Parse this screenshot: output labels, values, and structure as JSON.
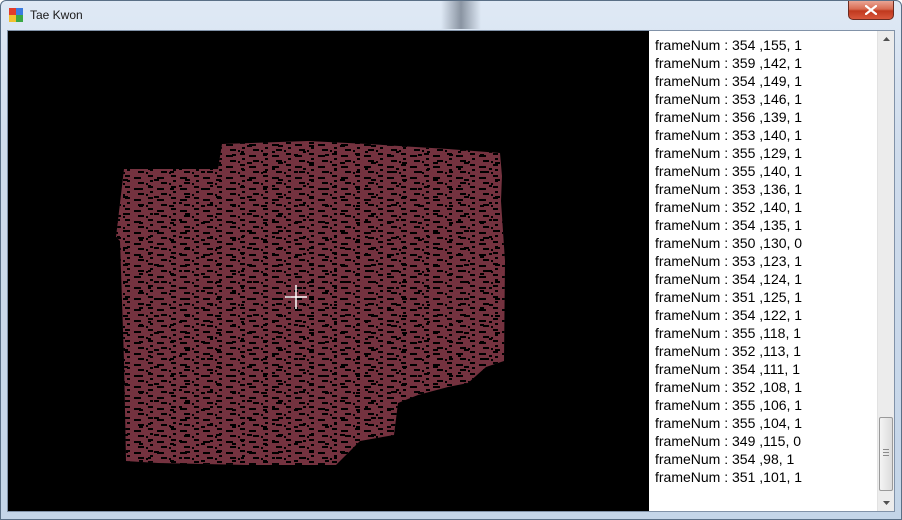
{
  "window": {
    "title": "Tae Kwon"
  },
  "colors": {
    "blob": "#74323f",
    "background": "#000000",
    "crosshair": "#ffffff"
  },
  "log": {
    "lines": [
      "frameNum : 354 ,155, 1",
      "frameNum : 359 ,142, 1",
      "frameNum : 354 ,149, 1",
      "frameNum : 353 ,146, 1",
      "frameNum : 356 ,139, 1",
      "frameNum : 353 ,140, 1",
      "frameNum : 355 ,129, 1",
      "frameNum : 355 ,140, 1",
      "frameNum : 353 ,136, 1",
      "frameNum : 352 ,140, 1",
      "frameNum : 354 ,135, 1",
      "frameNum : 350 ,130, 0",
      "frameNum : 353 ,123, 1",
      "frameNum : 354 ,124, 1",
      "frameNum : 351 ,125, 1",
      "frameNum : 354 ,122, 1",
      "frameNum : 355 ,118, 1",
      "frameNum : 352 ,113, 1",
      "frameNum : 354 ,111, 1",
      "frameNum : 352 ,108, 1",
      "frameNum : 355 ,106, 1",
      "frameNum : 355 ,104, 1",
      "frameNum : 349 ,115, 0",
      "frameNum : 354 ,98, 1",
      "frameNum : 351 ,101, 1"
    ]
  }
}
